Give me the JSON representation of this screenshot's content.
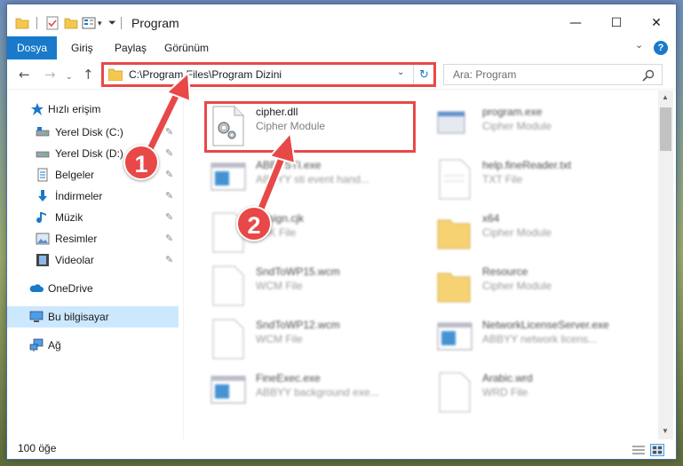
{
  "window": {
    "title": "Program",
    "controls": {
      "minimize": "—",
      "maximize": "☐",
      "close": "✕"
    }
  },
  "ribbon": {
    "tabs": [
      "Dosya",
      "Giriş",
      "Paylaş",
      "Görünüm"
    ],
    "help": "?"
  },
  "navigation": {
    "back": "←",
    "forward": "→",
    "recent": "⌄",
    "up": "↑"
  },
  "address": {
    "path": "C:\\Program Files\\Program Dizini",
    "dropdown": "⌄",
    "refresh": "↻"
  },
  "search": {
    "placeholder": "Ara: Program"
  },
  "sidebar": {
    "items": [
      {
        "label": "Hızlı erişim",
        "icon": "star-icon",
        "pinned": false
      },
      {
        "label": "Yerel Disk (C:)",
        "icon": "drive-icon",
        "pinned": true
      },
      {
        "label": "Yerel Disk (D:)",
        "icon": "drive-icon",
        "pinned": true
      },
      {
        "label": "Belgeler",
        "icon": "documents-icon",
        "pinned": true
      },
      {
        "label": "İndirmeler",
        "icon": "downloads-icon",
        "pinned": true
      },
      {
        "label": "Müzik",
        "icon": "music-icon",
        "pinned": true
      },
      {
        "label": "Resimler",
        "icon": "pictures-icon",
        "pinned": true
      },
      {
        "label": "Videolar",
        "icon": "videos-icon",
        "pinned": true
      },
      {
        "label": "OneDrive",
        "icon": "cloud-icon",
        "pinned": false
      },
      {
        "label": "Bu bilgisayar",
        "icon": "computer-icon",
        "pinned": false,
        "selected": true
      },
      {
        "label": "Ağ",
        "icon": "network-icon",
        "pinned": false
      }
    ],
    "pin_glyph": "📌"
  },
  "files": [
    {
      "name": "cipher.dll",
      "desc": "Cipher Module",
      "icon": "dll-gear-icon",
      "blurred": false
    },
    {
      "name": "program.exe",
      "desc": "Cipher Module",
      "icon": "exe-icon",
      "blurred": true
    },
    {
      "name": "ABBYSTI.exe",
      "desc": "ABBYY sti event hand...",
      "icon": "exe-window-icon",
      "blurred": true
    },
    {
      "name": "help.fineReader.txt",
      "desc": "TXT File",
      "icon": "text-file-icon",
      "blurred": true
    },
    {
      "name": "Assign.cjk",
      "desc": "CJK File",
      "icon": "blank-file-icon",
      "blurred": true
    },
    {
      "name": "x64",
      "desc": "Cipher Module",
      "icon": "folder-icon",
      "blurred": true
    },
    {
      "name": "SndToWP15.wcm",
      "desc": "WCM File",
      "icon": "blank-file-icon",
      "blurred": true
    },
    {
      "name": "Resource",
      "desc": "Cipher Module",
      "icon": "folder-icon",
      "blurred": true
    },
    {
      "name": "SndToWP12.wcm",
      "desc": "WCM File",
      "icon": "blank-file-icon",
      "blurred": true
    },
    {
      "name": "NetworkLicenseServer.exe",
      "desc": "ABBYY network licens...",
      "icon": "exe-window-icon",
      "blurred": true
    },
    {
      "name": "FineExec.exe",
      "desc": "ABBYY background exe...",
      "icon": "exe-window-icon",
      "blurred": true
    },
    {
      "name": "Arabic.wrd",
      "desc": "WRD File",
      "icon": "blank-file-icon",
      "blurred": true
    }
  ],
  "status": {
    "item_count": "100 öğe"
  },
  "annotations": {
    "step1": "1",
    "step2": "2",
    "color": "#e84848"
  },
  "colors": {
    "accent": "#1979ca",
    "selection": "#cce8ff",
    "highlight": "#e84848",
    "folder": "#f4c84f"
  }
}
